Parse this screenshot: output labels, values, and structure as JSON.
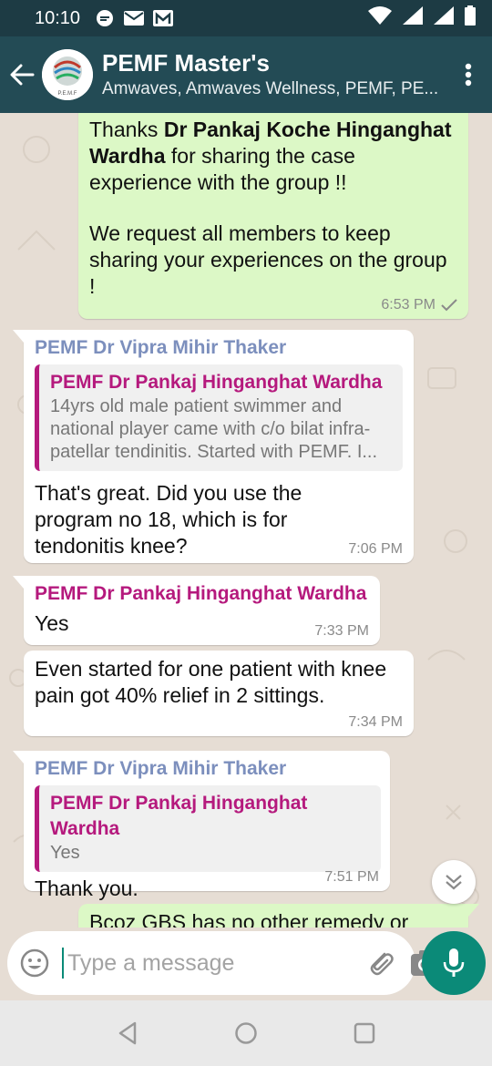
{
  "status_bar": {
    "time": "10:10"
  },
  "header": {
    "title": "PEMF Master's",
    "subtitle": "Amwaves, Amwaves Wellness, PEMF, PE...",
    "avatar_caption": "P.E.M.F"
  },
  "messages": [
    {
      "id": "m1",
      "direction": "outgoing",
      "segments": [
        {
          "text": "Thanks ",
          "bold": false
        },
        {
          "text": "Dr Pankaj Koche Hinganghat Wardha",
          "bold": true
        },
        {
          "text": " for sharing the case experience with the group !!",
          "bold": false
        }
      ],
      "paragraph2": "We request all members to keep sharing your experiences on the group !",
      "time": "6:53 PM",
      "status": "sent"
    },
    {
      "id": "m2",
      "direction": "incoming",
      "sender": "PEMF Dr Vipra Mihir Thaker",
      "quote": {
        "sender": "PEMF Dr Pankaj Hinganghat Wardha",
        "text": "14yrs old male patient swimmer and national player came with c/o bilat infra-patellar tendinitis. Started with PEMF. I..."
      },
      "text": "That's great. Did you use the program no 18, which is for tendonitis knee?",
      "time": "7:06 PM"
    },
    {
      "id": "m3",
      "direction": "incoming",
      "sender": "PEMF Dr Pankaj Hinganghat Wardha",
      "text": "Yes",
      "time": "7:33 PM"
    },
    {
      "id": "m4",
      "direction": "incoming",
      "text": "Even started for one patient with knee pain got 40% relief in 2 sittings.",
      "time": "7:34 PM"
    },
    {
      "id": "m5",
      "direction": "incoming",
      "sender": "PEMF Dr Vipra Mihir Thaker",
      "quote": {
        "sender": "PEMF Dr Pankaj Hinganghat Wardha",
        "text": "Yes"
      },
      "text": "Thank you.",
      "time": "7:51 PM"
    },
    {
      "id": "m6",
      "direction": "outgoing",
      "text": "Bcoz GBS has no other remedy or"
    }
  ],
  "input": {
    "placeholder": "Type a message"
  },
  "colors": {
    "header": "#234b55",
    "status_bar": "#1d3b44",
    "outgoing_bubble": "#dcf8c6",
    "incoming_bubble": "#ffffff",
    "sender_blue": "#7c8fbd",
    "sender_magenta": "#b5197d",
    "accent": "#0b8a78",
    "chat_background": "#e6ddd4"
  },
  "icons": {
    "back": "arrow-left-icon",
    "menu": "more-vert-icon",
    "emoji": "smiley-icon",
    "attach": "paperclip-icon",
    "camera": "camera-icon",
    "mic": "microphone-icon",
    "scroll_down": "double-chevron-down-icon",
    "read_tick": "check-icon"
  }
}
